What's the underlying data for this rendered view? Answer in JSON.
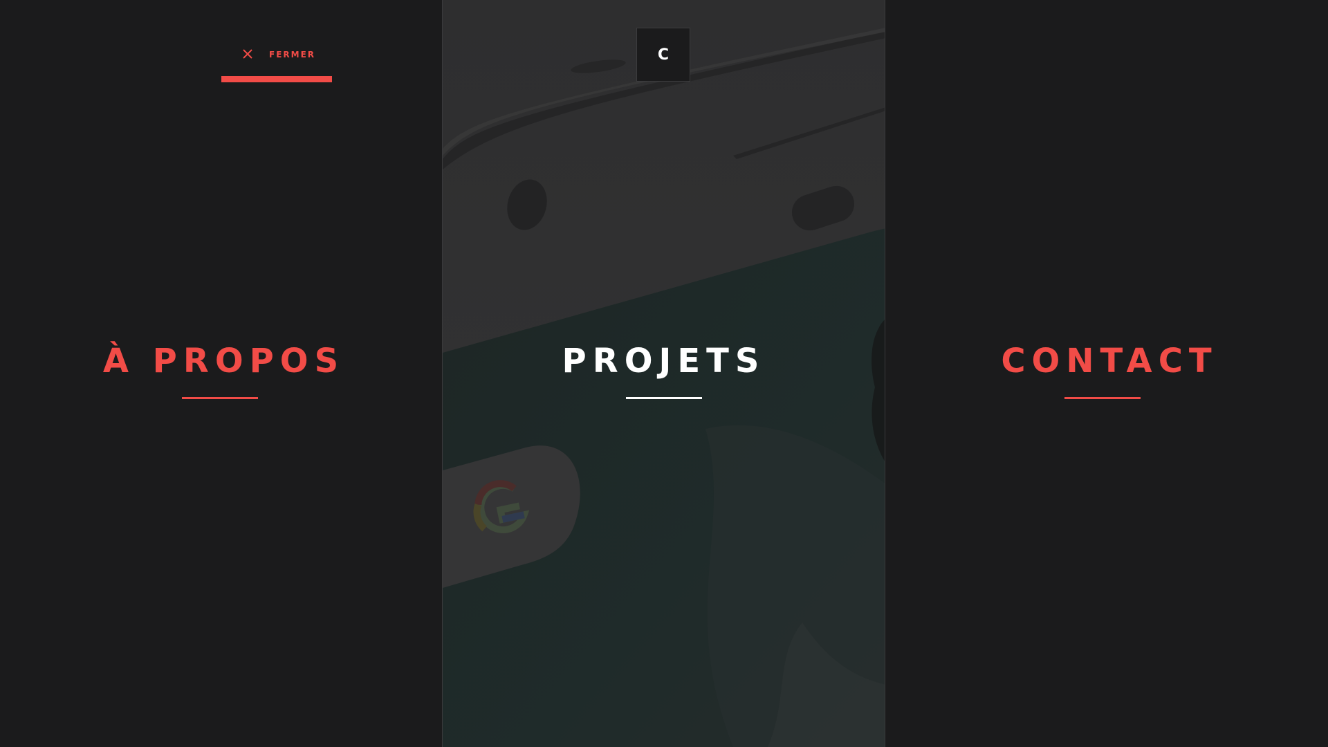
{
  "close_button": {
    "label": "FERMER"
  },
  "logo": {
    "text": "C"
  },
  "nav": {
    "about": {
      "label": "À PROPOS"
    },
    "projects": {
      "label": "PROJETS"
    },
    "contact": {
      "label": "CONTACT"
    }
  },
  "colors": {
    "accent": "#f24c47",
    "background": "#1b1b1c",
    "center_panel": "#303031",
    "text_light": "#ffffff"
  },
  "icons": {
    "close": "close-icon",
    "google_logo": "google-g-icon"
  }
}
